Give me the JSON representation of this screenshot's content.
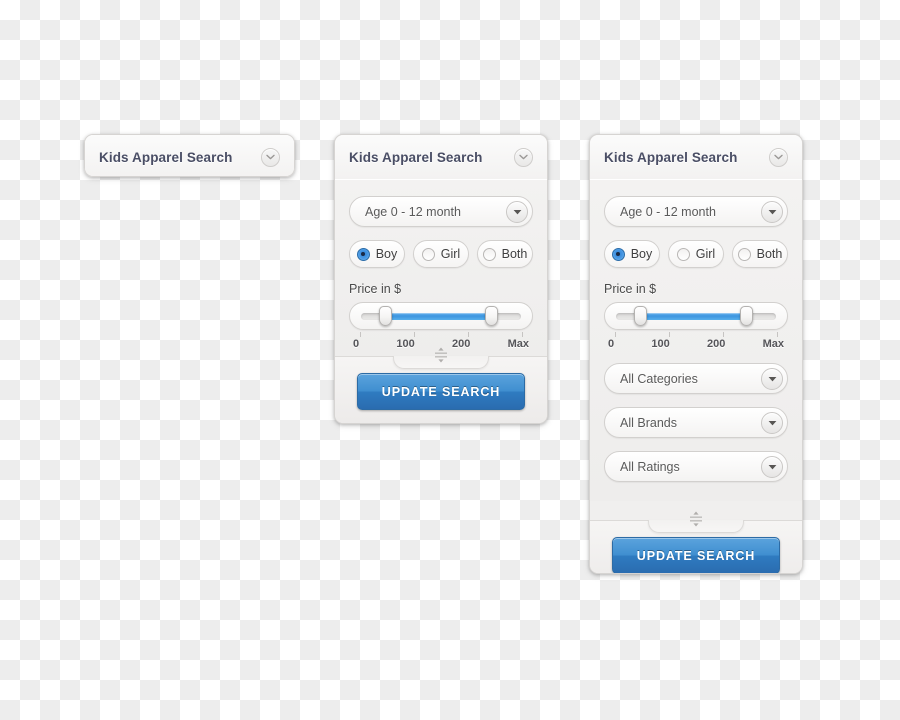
{
  "panels": [
    {
      "id": "collapsed",
      "title": "Kids Apparel Search",
      "collapse_icon": "chevron-down-icon"
    },
    {
      "id": "medium",
      "title": "Kids Apparel Search",
      "collapse_icon": "chevron-down-icon",
      "age_select": {
        "value": "Age 0 - 12 month",
        "arrow_icon": "triangle-down-icon"
      },
      "gender": {
        "options": [
          {
            "label": "Boy",
            "selected": true
          },
          {
            "label": "Girl",
            "selected": false
          },
          {
            "label": "Both",
            "selected": false
          }
        ]
      },
      "price": {
        "label": "Price in $",
        "scale": [
          "0",
          "100",
          "200",
          "Max"
        ],
        "min_percent": 15,
        "max_percent": 81
      },
      "resize_icon": "resize-vertical-icon",
      "update_label": "UPDATE SEARCH"
    },
    {
      "id": "expanded",
      "title": "Kids Apparel Search",
      "collapse_icon": "chevron-down-icon",
      "age_select": {
        "value": "Age 0 - 12 month",
        "arrow_icon": "triangle-down-icon"
      },
      "gender": {
        "options": [
          {
            "label": "Boy",
            "selected": true
          },
          {
            "label": "Girl",
            "selected": false
          },
          {
            "label": "Both",
            "selected": false
          }
        ]
      },
      "price": {
        "label": "Price in $",
        "scale": [
          "0",
          "100",
          "200",
          "Max"
        ],
        "min_percent": 15,
        "max_percent": 81
      },
      "extra_selects": [
        {
          "value": "All Categories",
          "arrow_icon": "triangle-down-icon"
        },
        {
          "value": "All Brands",
          "arrow_icon": "triangle-down-icon"
        },
        {
          "value": "All Ratings",
          "arrow_icon": "triangle-down-icon"
        }
      ],
      "resize_icon": "resize-vertical-icon",
      "update_label": "UPDATE SEARCH"
    }
  ],
  "colors": {
    "accent_blue": "#3f97e0",
    "button_blue_top": "#5ba3dd",
    "button_blue_bottom": "#2a6cb0",
    "title_text": "#4a4e65",
    "panel_bg": "#f0efee"
  }
}
